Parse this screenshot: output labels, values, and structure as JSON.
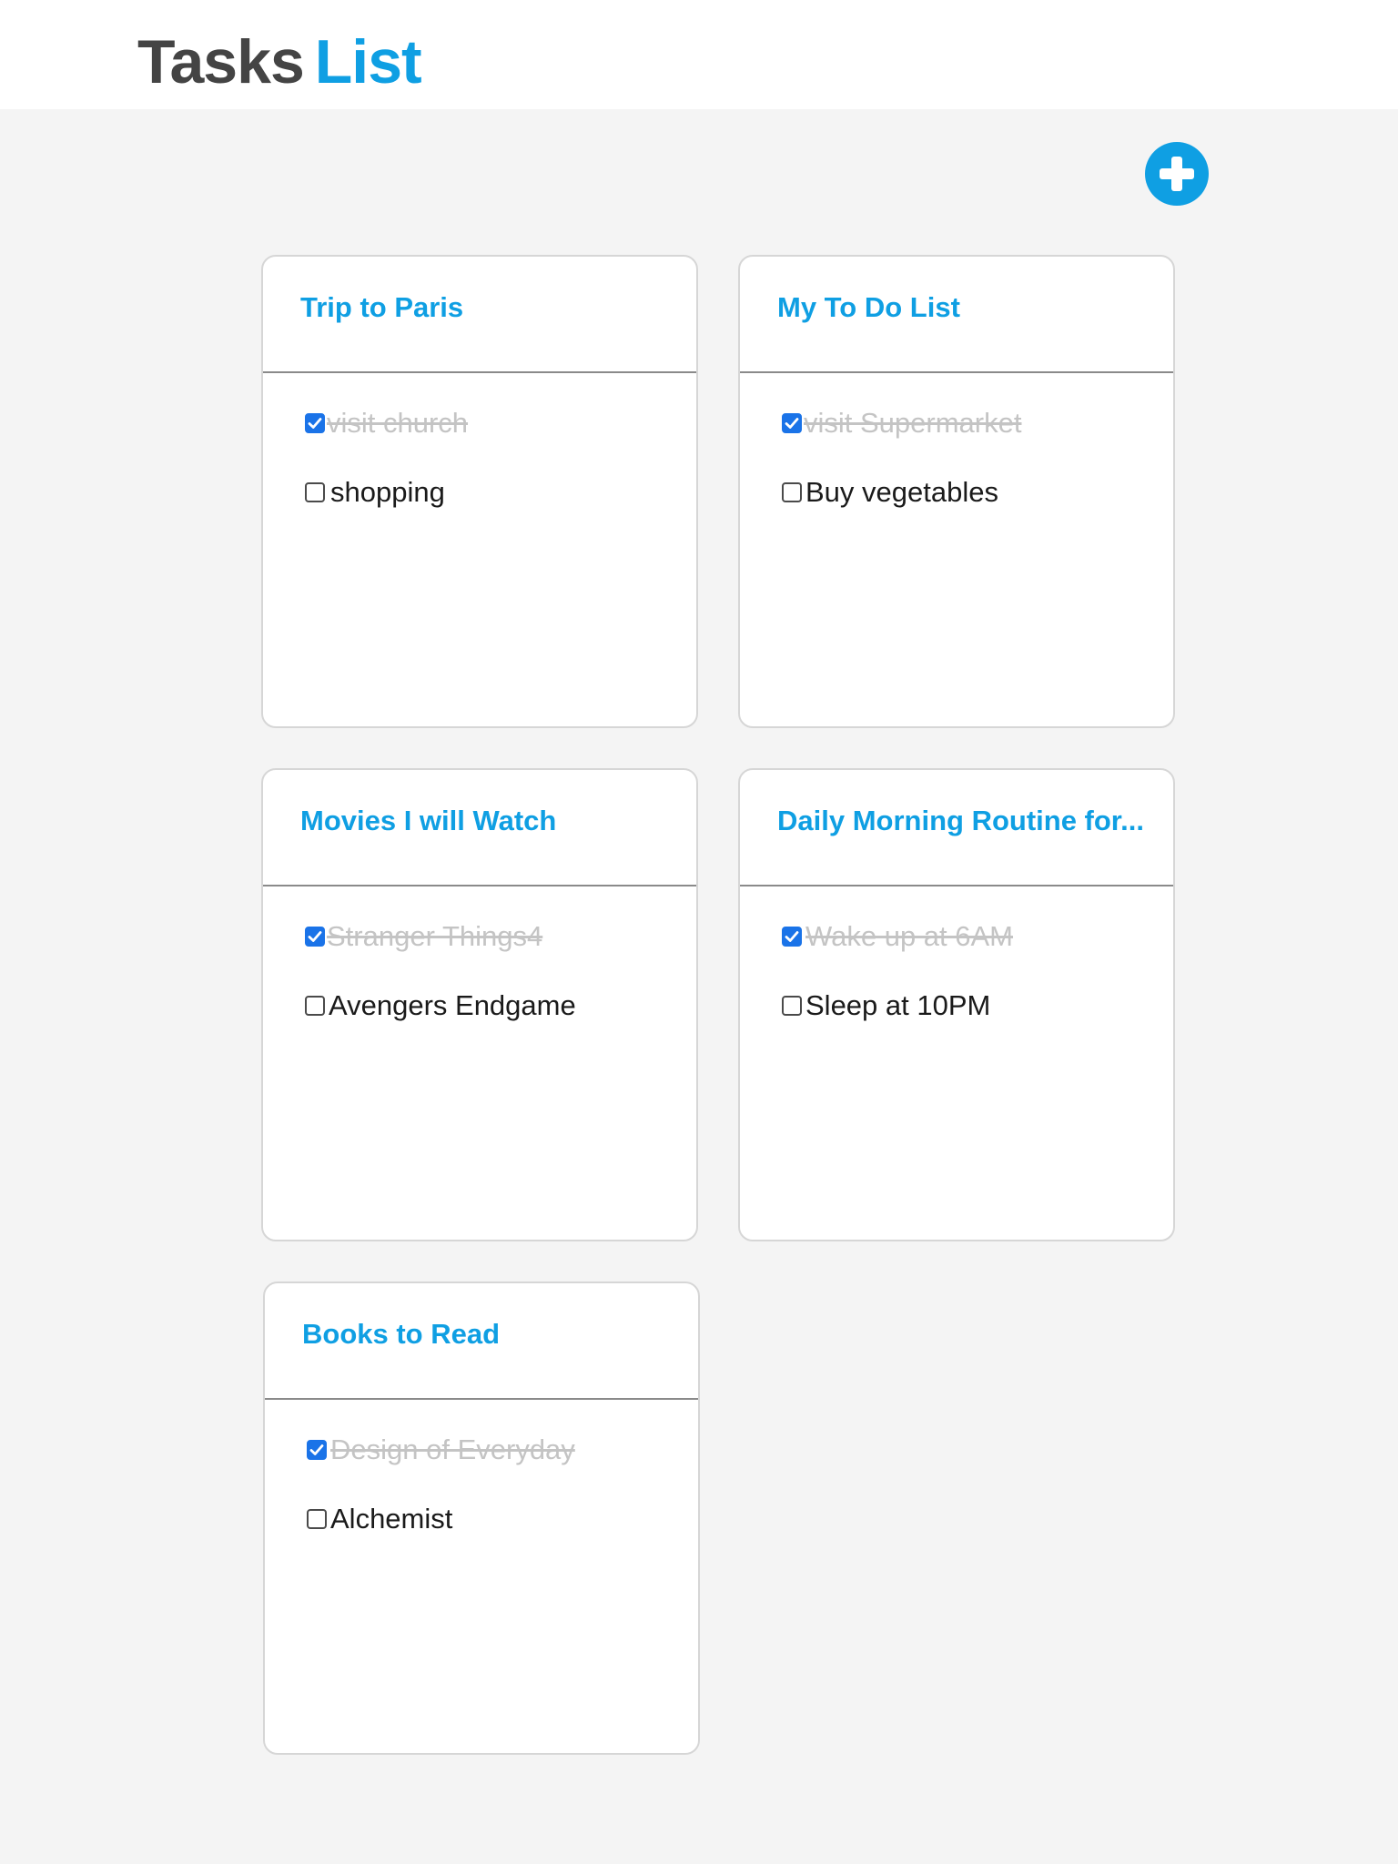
{
  "header": {
    "title_part1": "Tasks",
    "title_part2": "List"
  },
  "add_button": {
    "icon": "plus-circle-icon"
  },
  "colors": {
    "accent": "#0f9fe3",
    "checkbox": "#1a73e8",
    "done_text": "#c4c4c4"
  },
  "cards": [
    {
      "title": "Trip to Paris",
      "tasks": [
        {
          "label": " visit church",
          "done": true
        },
        {
          "label": "shopping",
          "done": false
        }
      ]
    },
    {
      "title": "My To Do List",
      "tasks": [
        {
          "label": " visit Supermarket",
          "done": true
        },
        {
          "label": " Buy vegetables",
          "done": false
        }
      ]
    },
    {
      "title": "Movies I will Watch",
      "tasks": [
        {
          "label": " Stranger Things4",
          "done": true
        },
        {
          "label": " Avengers Endgame",
          "done": false
        }
      ]
    },
    {
      "title": "Daily Morning Routine for...",
      "tasks": [
        {
          "label": "Wake up at 6AM",
          "done": true
        },
        {
          "label": "Sleep at 10PM",
          "done": false
        }
      ]
    },
    {
      "title": "Books to Read",
      "tasks": [
        {
          "label": "Design of Everyday",
          "done": true
        },
        {
          "label": "Alchemist",
          "done": false
        }
      ]
    }
  ]
}
